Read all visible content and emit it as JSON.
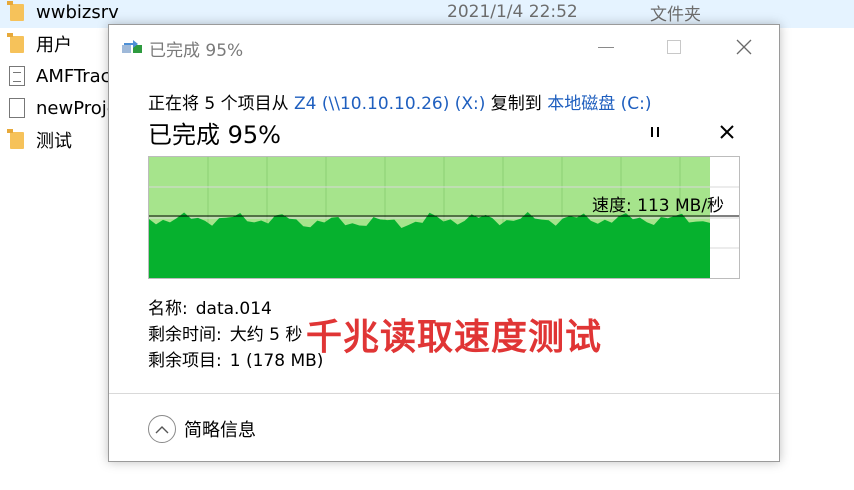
{
  "explorer": {
    "files": [
      {
        "name": "wwbizsrv",
        "date": "2021/1/4 22:52",
        "type": "文件夹",
        "icon": "folder-icon",
        "selected": true
      },
      {
        "name": "用户",
        "date": "",
        "type": "",
        "icon": "folder-icon",
        "selected": false
      },
      {
        "name": "AMFTrac",
        "date": "",
        "type": "",
        "icon": "document-icon",
        "selected": false
      },
      {
        "name": "newProje",
        "date": "",
        "type": "",
        "icon": "blank-file-icon",
        "selected": false
      },
      {
        "name": "测试",
        "date": "",
        "type": "",
        "icon": "folder-icon",
        "selected": false
      }
    ]
  },
  "dialog": {
    "title": "已完成 95%",
    "summary": {
      "prefix": "正在将 5 个项目从 ",
      "source": "Z4 (\\\\10.10.10.26) (X:)",
      "middle": " 复制到 ",
      "destination": "本地磁盘 (C:)"
    },
    "headline": "已完成 95%",
    "progress_percent": 95,
    "speed_label": "速度: 113 MB/秒",
    "details": {
      "name_label": "名称:",
      "name_value": "data.014",
      "time_label": "剩余时间:",
      "time_value": "大约 5 秒",
      "items_label": "剩余项目:",
      "items_value": "1 (178 MB)"
    },
    "less_details_label": "简略信息",
    "colors": {
      "progress_fill": "#a6e48c",
      "throughput_fill": "#06b12e",
      "grid_line": "#8ccf75",
      "link": "#1f5fbf"
    }
  },
  "caption": "千兆读取速度测试"
}
